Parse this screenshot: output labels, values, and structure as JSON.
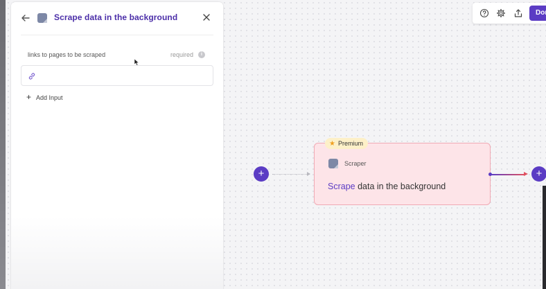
{
  "panel": {
    "title": "Scrape data in the background",
    "field": {
      "label": "links to pages to be scraped",
      "required_label": "required",
      "value": "",
      "placeholder": ""
    },
    "add_input_label": "Add Input"
  },
  "toolbar": {
    "done_label": "Done"
  },
  "node": {
    "badge": "Premium",
    "type": "Scraper",
    "title_highlight": "Scrape",
    "title_rest": " data in the background"
  },
  "colors": {
    "accent": "#5b3cc4",
    "node_bg": "#fde4e8",
    "node_border": "#f1a9b4",
    "badge_bg": "#fdf0c8"
  },
  "icons": {
    "back": "arrow-left-icon",
    "close": "close-icon",
    "info": "info-icon",
    "link": "link-icon",
    "add": "plus-icon",
    "help": "help-icon",
    "settings": "gear-icon",
    "share": "share-icon",
    "star": "star-icon"
  }
}
